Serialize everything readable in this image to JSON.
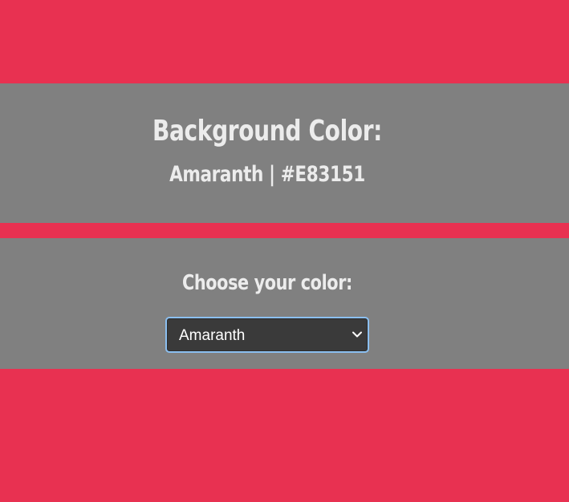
{
  "page": {
    "background_color": "#E83151",
    "panel_color": "#808080"
  },
  "display": {
    "title": "Background Color:",
    "current_value": "Amaranth | #E83151"
  },
  "picker": {
    "label": "Choose your color:",
    "selected": "Amaranth",
    "icon": "chevron-down-icon",
    "focus_color": "#8BBFF0"
  }
}
